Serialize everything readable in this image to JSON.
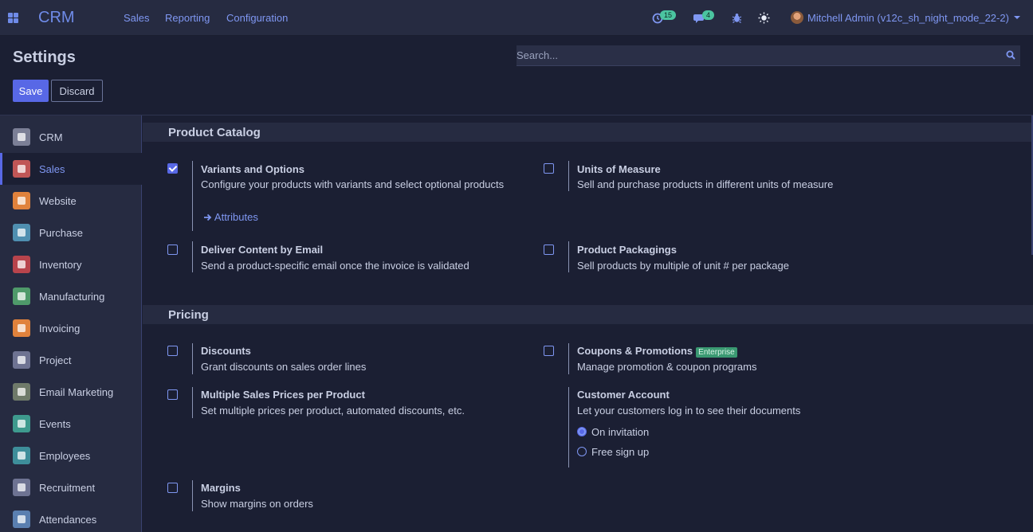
{
  "navbar": {
    "brand": "CRM",
    "menu": [
      "Sales",
      "Reporting",
      "Configuration"
    ],
    "activities_count": "15",
    "messages_count": "4",
    "user_name": "Mitchell Admin (v12c_sh_night_mode_22-2)"
  },
  "control_panel": {
    "title": "Settings",
    "search_placeholder": "Search...",
    "save_label": "Save",
    "discard_label": "Discard"
  },
  "sidebar": {
    "items": [
      {
        "label": "CRM",
        "icon": "crm-icon",
        "color": "#7b7f96"
      },
      {
        "label": "Sales",
        "icon": "sales-icon",
        "color": "#c05656"
      },
      {
        "label": "Website",
        "icon": "website-icon",
        "color": "#e0823c"
      },
      {
        "label": "Purchase",
        "icon": "purchase-icon",
        "color": "#4f8fb0"
      },
      {
        "label": "Inventory",
        "icon": "inventory-icon",
        "color": "#b8444c"
      },
      {
        "label": "Manufacturing",
        "icon": "manufacturing-icon",
        "color": "#4f9a6a"
      },
      {
        "label": "Invoicing",
        "icon": "invoicing-icon",
        "color": "#e0823c"
      },
      {
        "label": "Project",
        "icon": "project-icon",
        "color": "#6e7392"
      },
      {
        "label": "Email Marketing",
        "icon": "email-marketing-icon",
        "color": "#6f7a6a"
      },
      {
        "label": "Events",
        "icon": "events-icon",
        "color": "#3e9a8e"
      },
      {
        "label": "Employees",
        "icon": "employees-icon",
        "color": "#3e8e9a"
      },
      {
        "label": "Recruitment",
        "icon": "recruitment-icon",
        "color": "#6e7392"
      },
      {
        "label": "Attendances",
        "icon": "attendances-icon",
        "color": "#5a7fb0"
      }
    ],
    "active_index": 1
  },
  "sections": {
    "product_catalog": {
      "title": "Product Catalog",
      "variants": {
        "title": "Variants and Options",
        "desc": "Configure your products with variants and select optional products",
        "checked": true,
        "link": "Attributes"
      },
      "uom": {
        "title": "Units of Measure",
        "desc": "Sell and purchase products in different units of measure",
        "checked": false
      },
      "deliver_email": {
        "title": "Deliver Content by Email",
        "desc": "Send a product-specific email once the invoice is validated",
        "checked": false
      },
      "packagings": {
        "title": "Product Packagings",
        "desc": "Sell products by multiple of unit # per package",
        "checked": false
      }
    },
    "pricing": {
      "title": "Pricing",
      "discounts": {
        "title": "Discounts",
        "desc": "Grant discounts on sales order lines",
        "checked": false
      },
      "coupons": {
        "title": "Coupons & Promotions",
        "badge": "Enterprise",
        "desc": "Manage promotion & coupon programs",
        "checked": false
      },
      "multi_prices": {
        "title": "Multiple Sales Prices per Product",
        "desc": "Set multiple prices per product, automated discounts, etc.",
        "checked": false
      },
      "customer_account": {
        "title": "Customer Account",
        "desc": "Let your customers log in to see their documents",
        "options": [
          "On invitation",
          "Free sign up"
        ],
        "selected": 0
      },
      "margins": {
        "title": "Margins",
        "desc": "Show margins on orders",
        "checked": false
      }
    }
  }
}
